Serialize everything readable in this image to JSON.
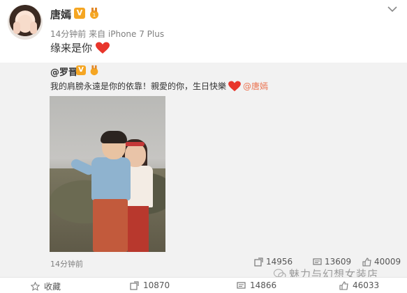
{
  "post": {
    "username": "唐嫣",
    "verified_badge": "V",
    "time_source": "14分钟前 来自 iPhone 7 Plus",
    "text": "缘来是你",
    "heart_color": "#e8352b"
  },
  "repost": {
    "username": "@罗晋",
    "verified_badge": "V",
    "text": "我的肩膀永遠是你的依靠！親愛的你，生日快樂",
    "mention": "@唐嫣",
    "time": "14分钟前",
    "reposts": "14956",
    "comments": "13609",
    "likes": "40009"
  },
  "watermark": "魅力与幻想女装店",
  "footer": {
    "favorite_label": "收藏",
    "repost_count": "10870",
    "comment_count": "14866",
    "like_count": "46033"
  },
  "colors": {
    "badge": "#f5a623",
    "mention": "#eb7350",
    "repost_bg": "#f2f2f2"
  },
  "icons": [
    "chevron-down-icon",
    "heart-icon",
    "medal-icon",
    "repost-icon",
    "comment-icon",
    "like-icon",
    "star-icon",
    "wechat-icon"
  ]
}
